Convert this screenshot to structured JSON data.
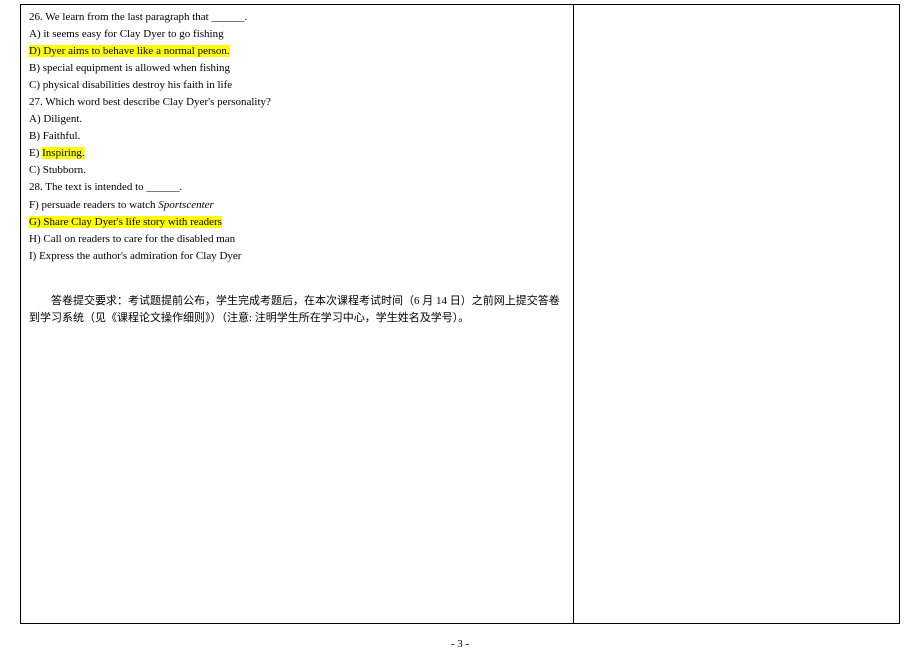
{
  "q26": {
    "text": "26. We learn from the last paragraph that  ______.",
    "optA": "A) it seems easy for Clay Dyer to go fishing",
    "optD": "D) Dyer aims to behave like a normal person.",
    "optB": "B) special equipment is allowed when fishing",
    "optC": "C) physical disabilities destroy his faith in life"
  },
  "q27": {
    "text": "27. Which word best describe Clay Dyer's personality?",
    "optA": "A) Diligent.",
    "optB": "B) Faithful.",
    "optE": "E) Inspiring.",
    "optC": "C) Stubborn."
  },
  "q28": {
    "text": "28. The text is intended to  ______.",
    "optF_prefix": "F) persuade readers to watch ",
    "optF_italic": "Sportscenter",
    "optG": "G) Share Clay Dyer's life story with readers",
    "optH": "H) Call on readers to care for the disabled man",
    "optI": "I) Express the author's admiration for Clay Dyer"
  },
  "instructions": "答卷提交要求：考试题提前公布，学生完成考题后，在本次课程考试时间（6 月 14 日）之前网上提交答卷到学习系统（见《课程论文操作细则》）（注意: 注明学生所在学习中心，学生姓名及学号）。",
  "page_number": "- 3 -"
}
